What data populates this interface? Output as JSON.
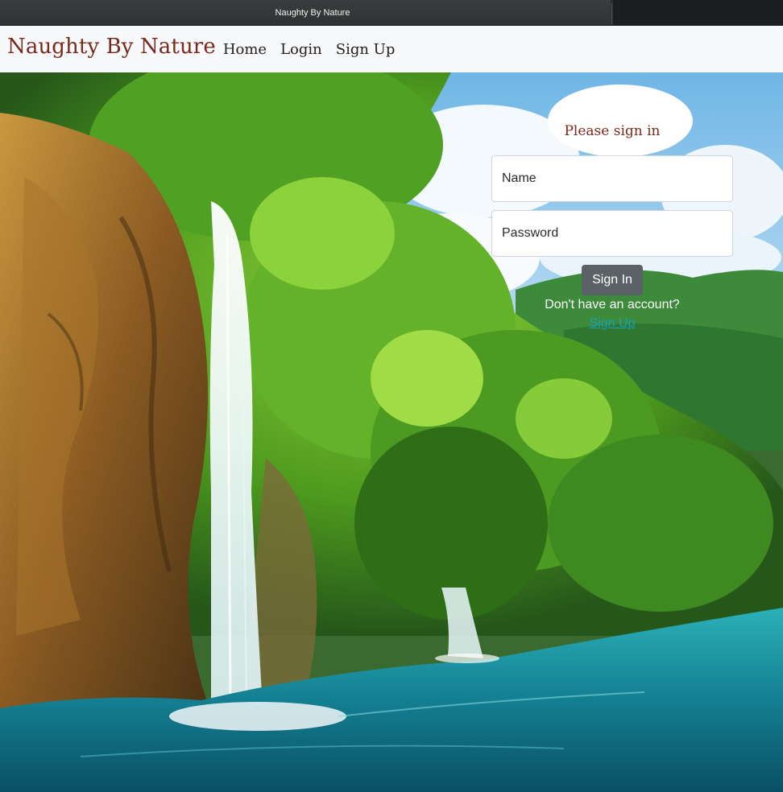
{
  "window": {
    "tab_title": "Naughty By Nature"
  },
  "navbar": {
    "brand": "Naughty By Nature",
    "links": [
      "Home",
      "Login",
      "Sign Up"
    ]
  },
  "signin": {
    "title": "Please sign in",
    "name_placeholder": "Name",
    "password_placeholder": "Password",
    "button_label": "Sign In",
    "no_account_text": "Don't have an account?",
    "signup_link": "Sign Up"
  },
  "colors": {
    "brand": "#7a2a1c",
    "button": "#5a6268",
    "link": "#17a2b8",
    "navbar_bg": "#f8f9fa"
  }
}
